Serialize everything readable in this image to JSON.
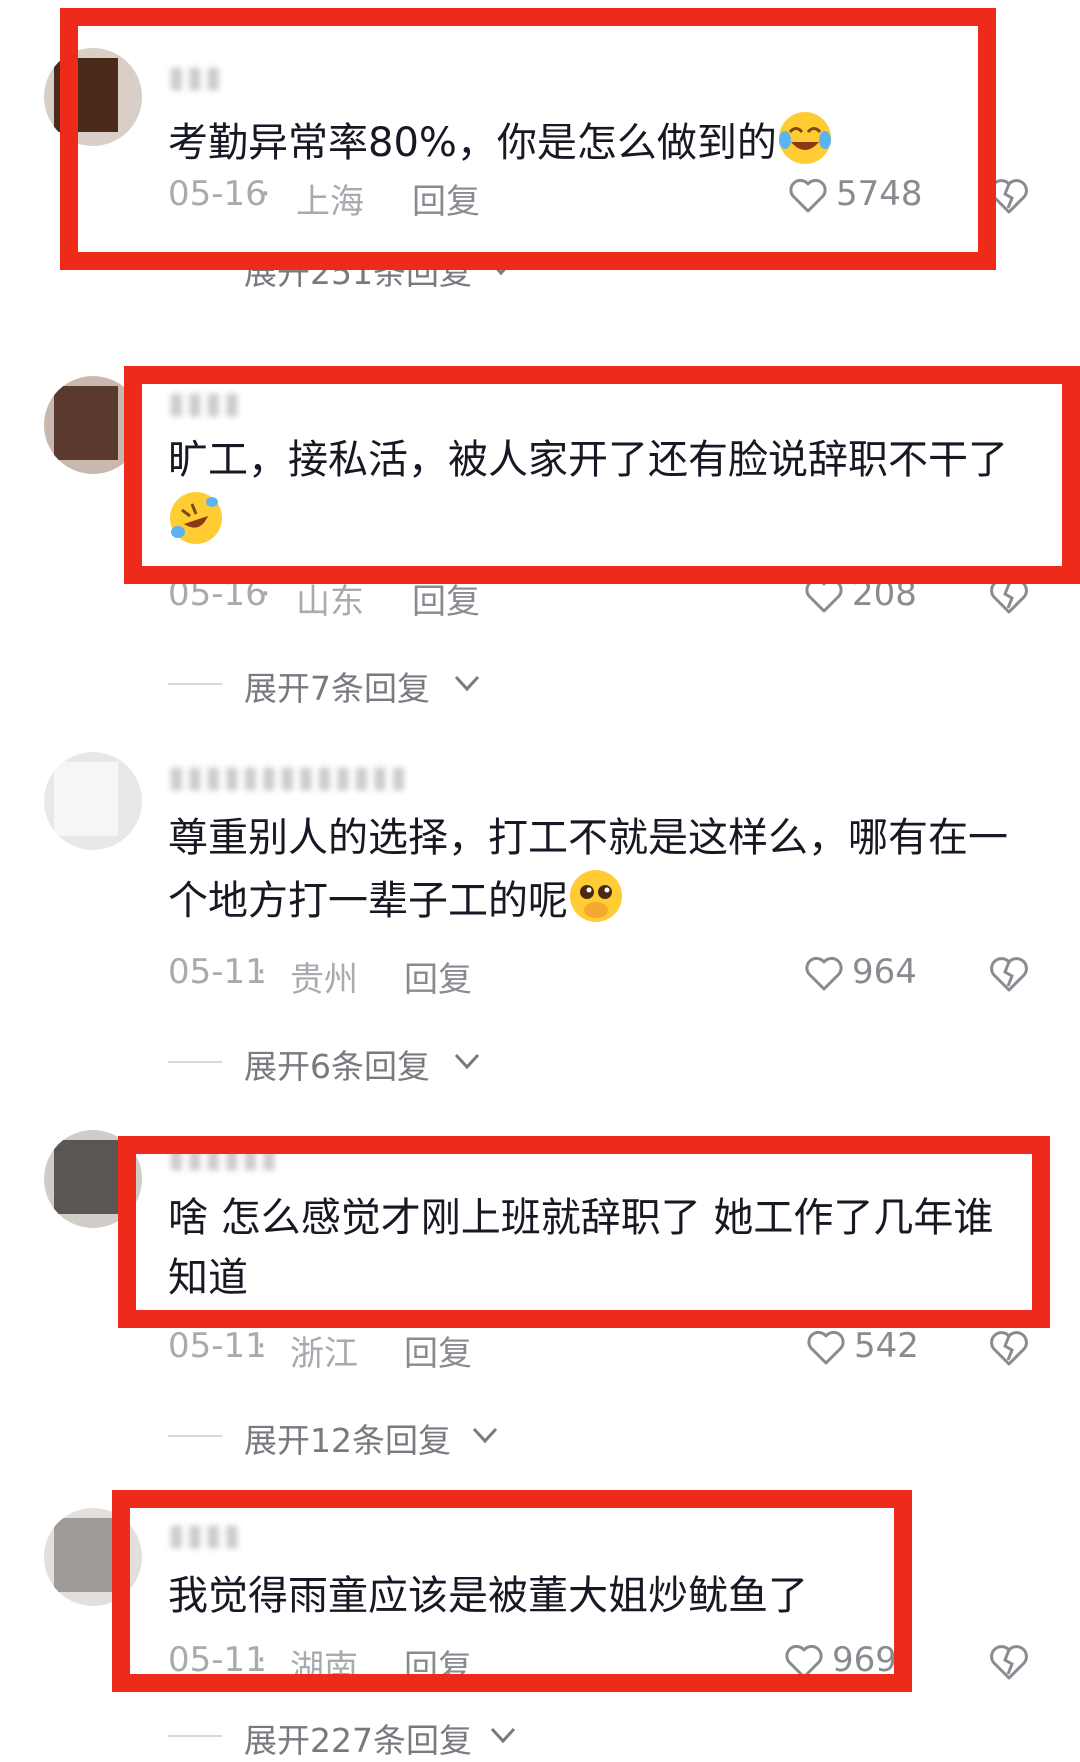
{
  "comments": [
    {
      "content": "考勤异常率80%，你是怎么做到的",
      "date": "05-16",
      "location": "上海",
      "reply_label": "回复",
      "likes": "5748",
      "expand_label": "展开251条回复",
      "emoji_icon": "crying-laughing-face-icon"
    },
    {
      "content": "旷工，接私活，被人家开了还有脸说辞职不干了",
      "date": "05-16",
      "location": "山东",
      "reply_label": "回复",
      "likes": "208",
      "expand_label": "展开7条回复",
      "emoji_icon": "rolling-laughing-face-icon"
    },
    {
      "content_line1": "尊重别人的选择，打工不就是这样么，哪有在一",
      "content_line2": "个地方打一辈子工的呢",
      "date": "05-11",
      "location": "贵州",
      "reply_label": "回复",
      "likes": "964",
      "expand_label": "展开6条回复",
      "emoji_icon": "pleading-face-icon"
    },
    {
      "content_line1": "啥 怎么感觉才刚上班就辞职了 她工作了几年谁",
      "content_line2": "知道",
      "date": "05-11",
      "location": "浙江",
      "reply_label": "回复",
      "likes": "542",
      "expand_label": "展开12条回复"
    },
    {
      "content": "我觉得雨童应该是被董大姐炒鱿鱼了",
      "date": "05-11",
      "location": "湖南",
      "reply_label": "回复",
      "likes": "969",
      "expand_label": "展开227条回复"
    }
  ],
  "separator": "·",
  "colors": {
    "highlight_box": "#ee2a1a",
    "meta_text": "#a9aab0",
    "content_text": "#161823"
  }
}
